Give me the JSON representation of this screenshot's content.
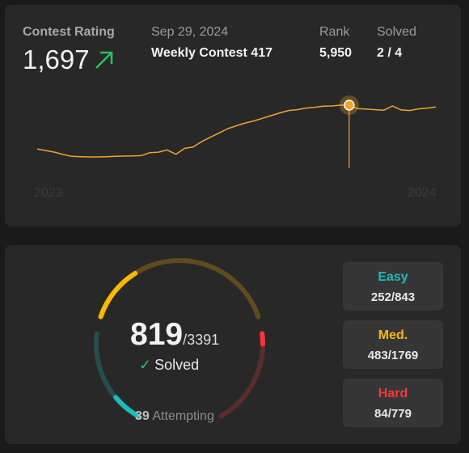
{
  "rating": {
    "label": "Contest Rating",
    "value": "1,697",
    "trend_icon": "arrow-up-right-icon",
    "trend_color": "#2cbc63"
  },
  "contest": {
    "date": "Sep 29, 2024",
    "name": "Weekly Contest 417",
    "rank_label": "Rank",
    "rank_value": "5,950",
    "solved_label": "Solved",
    "solved_value": "2 / 4"
  },
  "chart_data": {
    "type": "line",
    "x_tick_labels": [
      "2023",
      "2024"
    ],
    "line_color": "#f4a22d",
    "highlighted_point": {
      "date": "Sep 29, 2024",
      "rating": 1697
    },
    "series": [
      {
        "values": [
          1533,
          1527,
          1521,
          1512,
          1505,
          1504,
          1503,
          1503,
          1504,
          1505,
          1506,
          1507,
          1508,
          1519,
          1521,
          1529,
          1513,
          1535,
          1540,
          1561,
          1577,
          1593,
          1609,
          1620,
          1630,
          1638,
          1648,
          1658,
          1668,
          1677,
          1680,
          1686,
          1689,
          1693,
          1694,
          1697,
          1697,
          1684,
          1682,
          1680,
          1678,
          1694,
          1679,
          1677,
          1683,
          1686,
          1690
        ]
      }
    ]
  },
  "progress": {
    "solved": "819",
    "total": "/3391",
    "status": "Solved",
    "attempting_count": "39",
    "attempting_label": "Attempting",
    "easy_solved_fraction": 0.299,
    "medium_solved_fraction": 0.273,
    "hard_solved_fraction": 0.108
  },
  "difficulty": {
    "easy": {
      "label": "Easy",
      "count": "252/843",
      "color": "#1cbaba"
    },
    "medium": {
      "label": "Med.",
      "count": "483/1769",
      "color": "#ffb700"
    },
    "hard": {
      "label": "Hard",
      "count": "84/779",
      "color": "#f63737"
    }
  }
}
